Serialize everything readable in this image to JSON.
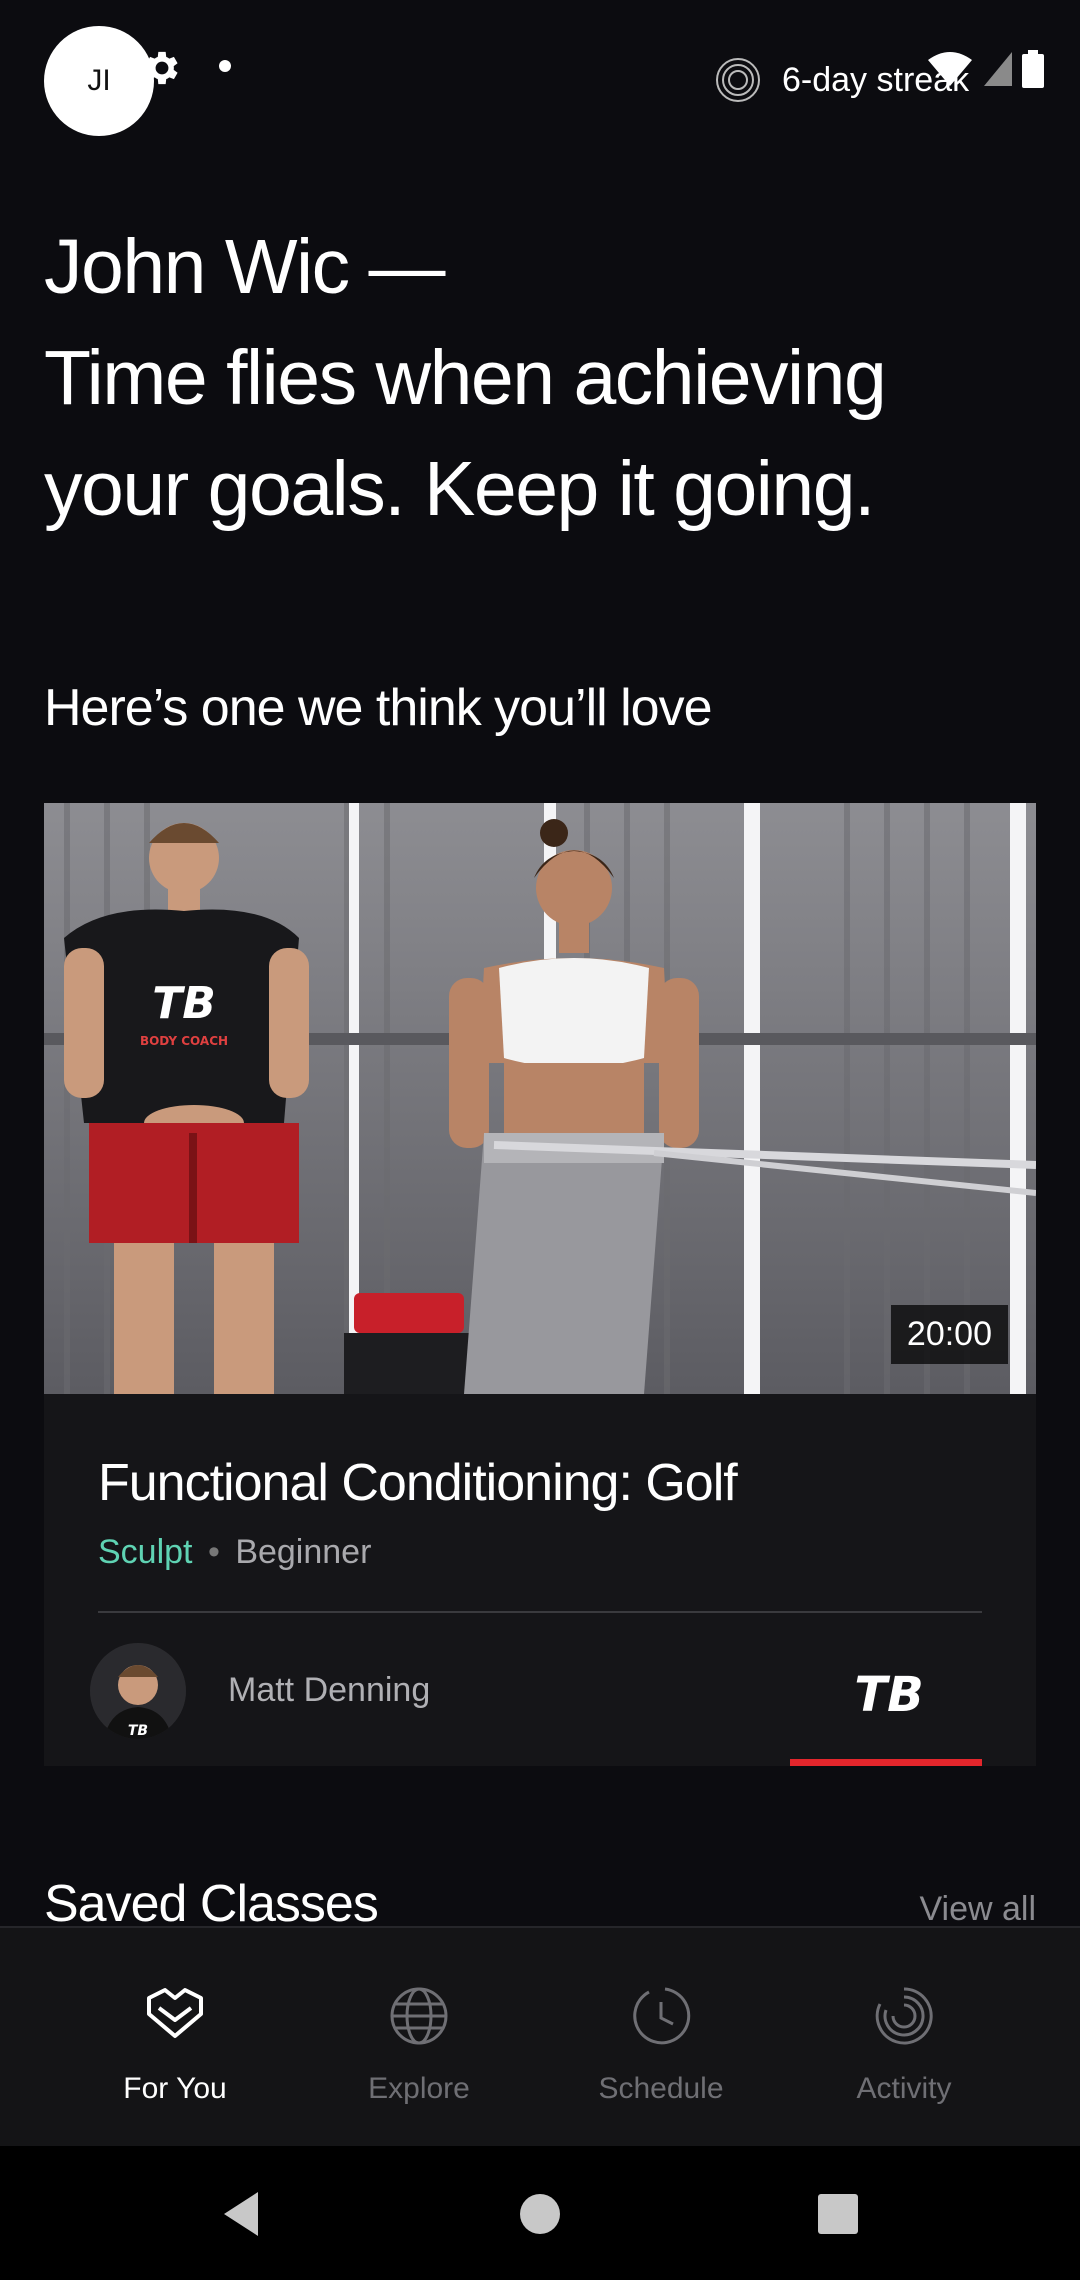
{
  "status_bar": {
    "avatar_initials": "JI",
    "streak_label": "6-day streak"
  },
  "greeting": {
    "line1": "John Wic —",
    "line2": "Time flies when achieving",
    "line3": "your goals. Keep it going."
  },
  "recommend": {
    "heading": "Here’s one we think you’ll love",
    "card": {
      "duration": "20:00",
      "title": "Functional Conditioning: Golf",
      "category": "Sculpt",
      "separator": "•",
      "level": "Beginner",
      "instructor": "Matt Denning",
      "shirt_text": "BODY COACH"
    }
  },
  "saved": {
    "heading": "Saved Classes",
    "view_all": "View all"
  },
  "bottom_nav": {
    "items": [
      {
        "label": "For You",
        "icon": "heart-icon",
        "active": true
      },
      {
        "label": "Explore",
        "icon": "globe-icon",
        "active": false
      },
      {
        "label": "Schedule",
        "icon": "clock-icon",
        "active": false
      },
      {
        "label": "Activity",
        "icon": "activity-icon",
        "active": false
      }
    ]
  },
  "colors": {
    "background": "#0c0c10",
    "card": "#151518",
    "accent_category": "#5fd3b3",
    "brand_red": "#e3262c"
  }
}
